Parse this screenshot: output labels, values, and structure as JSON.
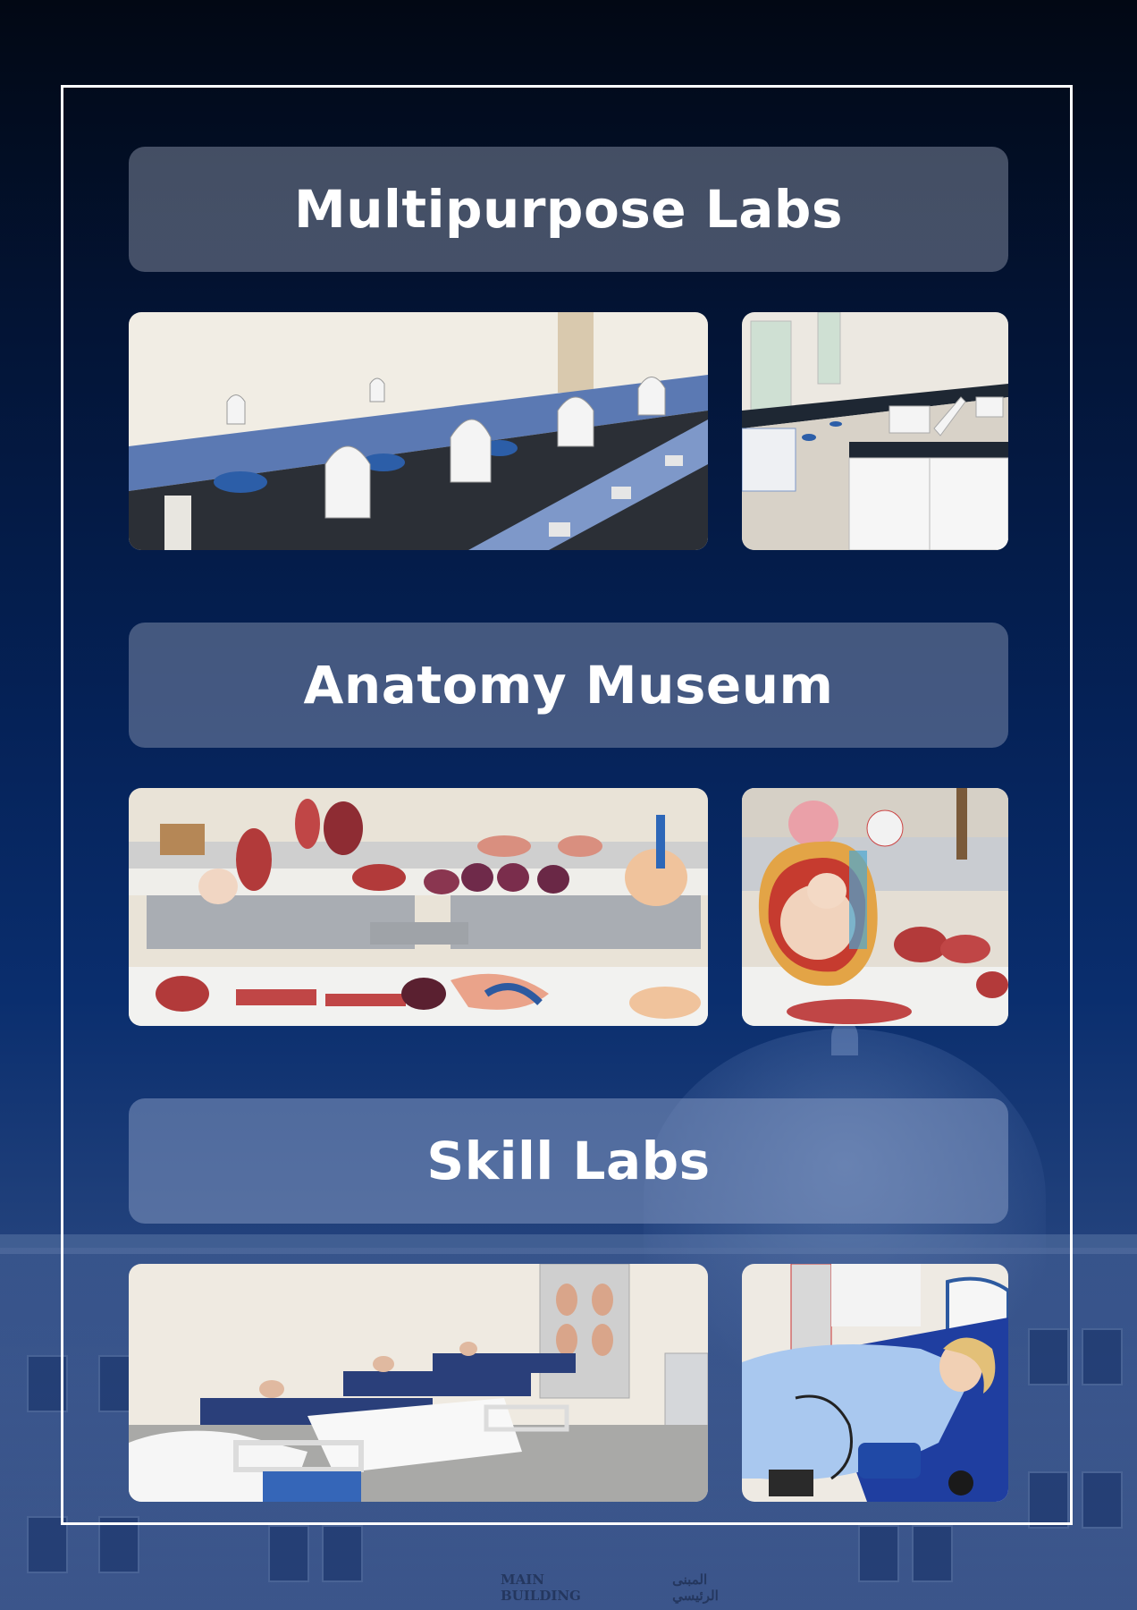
{
  "sections": [
    {
      "title": "Multipurpose Labs",
      "photos": [
        {
          "icon": "microscope-lab-photo"
        },
        {
          "icon": "lab-benches-photo"
        }
      ]
    },
    {
      "title": "Anatomy Museum",
      "photos": [
        {
          "icon": "anatomy-models-photo"
        },
        {
          "icon": "pregnancy-model-photo"
        }
      ]
    },
    {
      "title": "Skill Labs",
      "photos": [
        {
          "icon": "hospital-beds-photo"
        },
        {
          "icon": "patient-mannequin-photo"
        }
      ]
    }
  ],
  "background": {
    "building_sign_en": "MAIN BUILDING",
    "building_sign_ar": "المبنى الرئيسي"
  },
  "colors": {
    "background_top": "#020814",
    "background_bottom": "#3a5589",
    "banner_text": "#ffffff",
    "frame": "#ffffff"
  }
}
